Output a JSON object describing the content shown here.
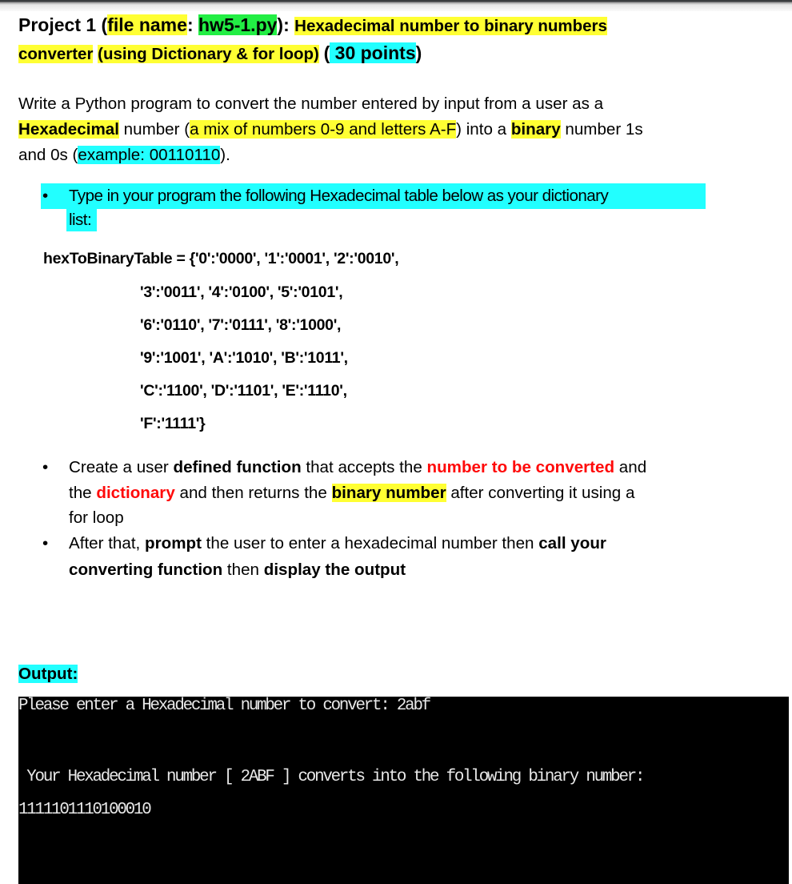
{
  "document": {
    "title": {
      "prefix": "Project 1 (",
      "file_label": "file name",
      "colon": ": ",
      "file_name": "hw5-1.py",
      "close": "): ",
      "topic_line1": "Hexadecimal number to binary numbers",
      "topic_line2_a": "converter",
      "topic_line2_b": "(using Dictionary & for loop)",
      "points_open": "(",
      "points": " 30 points",
      "points_close": ")"
    },
    "intro": {
      "line1": "Write a Python program  to convert the number entered by input from a user as a",
      "hex_word": "Hexadecimal",
      "l2_mid": " number (",
      "mix": "a mix of numbers 0-9 and letters A-F",
      "l2_after": ") into a ",
      "binary_word": "binary",
      "l2_end": " number 1s",
      "l3_start": "and 0s (",
      "example": "example: 00110110",
      "l3_end": ")."
    },
    "bullet1": {
      "bullet": "•",
      "line1": "Type in your program the following Hexadecimal table below as your dictionary",
      "line2": "list:"
    },
    "code": {
      "lines": [
        "hexToBinaryTable = {'0':'0000', '1':'0001', '2':'0010',",
        "'3':'0011', '4':'0100', '5':'0101',",
        "'6':'0110', '7':'0111', '8':'1000',",
        "'9':'1001', 'A':'1010', 'B':'1011',",
        "'C':'1100', 'D':'1101', 'E':'1110',",
        "'F':'1111'}"
      ]
    },
    "bullet2": {
      "bullet": "•",
      "l1_a": "Create a user ",
      "l1_b": "defined function",
      "l1_c": " that accepts the ",
      "l1_d": "number to be converted",
      "l1_e": " and",
      "l2_a": "the ",
      "l2_b": "dictionary",
      "l2_c": " and then returns the ",
      "l2_d": "binary number",
      "l2_e": " after converting it using a",
      "l3": "for loop"
    },
    "bullet3": {
      "bullet": "•",
      "l1_a": "After that, ",
      "l1_b": "prompt",
      "l1_c": " the user to enter a hexadecimal number then ",
      "l1_d": "call your",
      "l2_a": "converting function",
      "l2_b": " then ",
      "l2_c": "display the output"
    },
    "output_label": "Output:"
  },
  "terminal": {
    "prompt": "Please enter a Hexadecimal number to convert: 2abf",
    "result": " Your Hexadecimal number [ 2ABF ] converts into the following binary number:",
    "binary": "1111101110100010"
  },
  "colors": {
    "highlight_yellow": "#ffff33",
    "highlight_green": "#22ee44",
    "highlight_cyan": "#22ffff",
    "emphasis_red": "#ff0a0a",
    "terminal_bg": "#000000",
    "terminal_fg": "#e8e8e8"
  }
}
